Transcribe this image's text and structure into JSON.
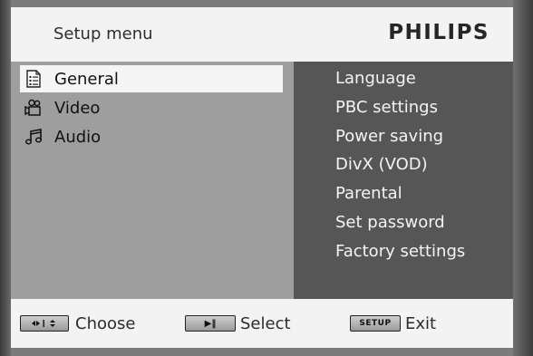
{
  "header": {
    "title": "Setup menu",
    "brand": "PHILIPS"
  },
  "menu": {
    "items": [
      {
        "label": "General",
        "icon": "document-list-icon",
        "selected": true
      },
      {
        "label": "Video",
        "icon": "video-camera-icon",
        "selected": false
      },
      {
        "label": "Audio",
        "icon": "music-note-icon",
        "selected": false
      }
    ]
  },
  "submenu": {
    "items": [
      "Language",
      "PBC settings",
      "Power saving",
      "DivX (VOD)",
      "Parental",
      "Set password",
      "Factory settings"
    ]
  },
  "footer": {
    "choose_label": "Choose",
    "select_label": "Select",
    "select_key": "▶‖",
    "exit_label": "Exit",
    "exit_key": "SETUP"
  },
  "colors": {
    "header_bg": "#f3f3f3",
    "left_panel_bg": "#9e9e9e",
    "right_panel_bg": "#565656",
    "selected_bg": "#f5f5f5"
  }
}
